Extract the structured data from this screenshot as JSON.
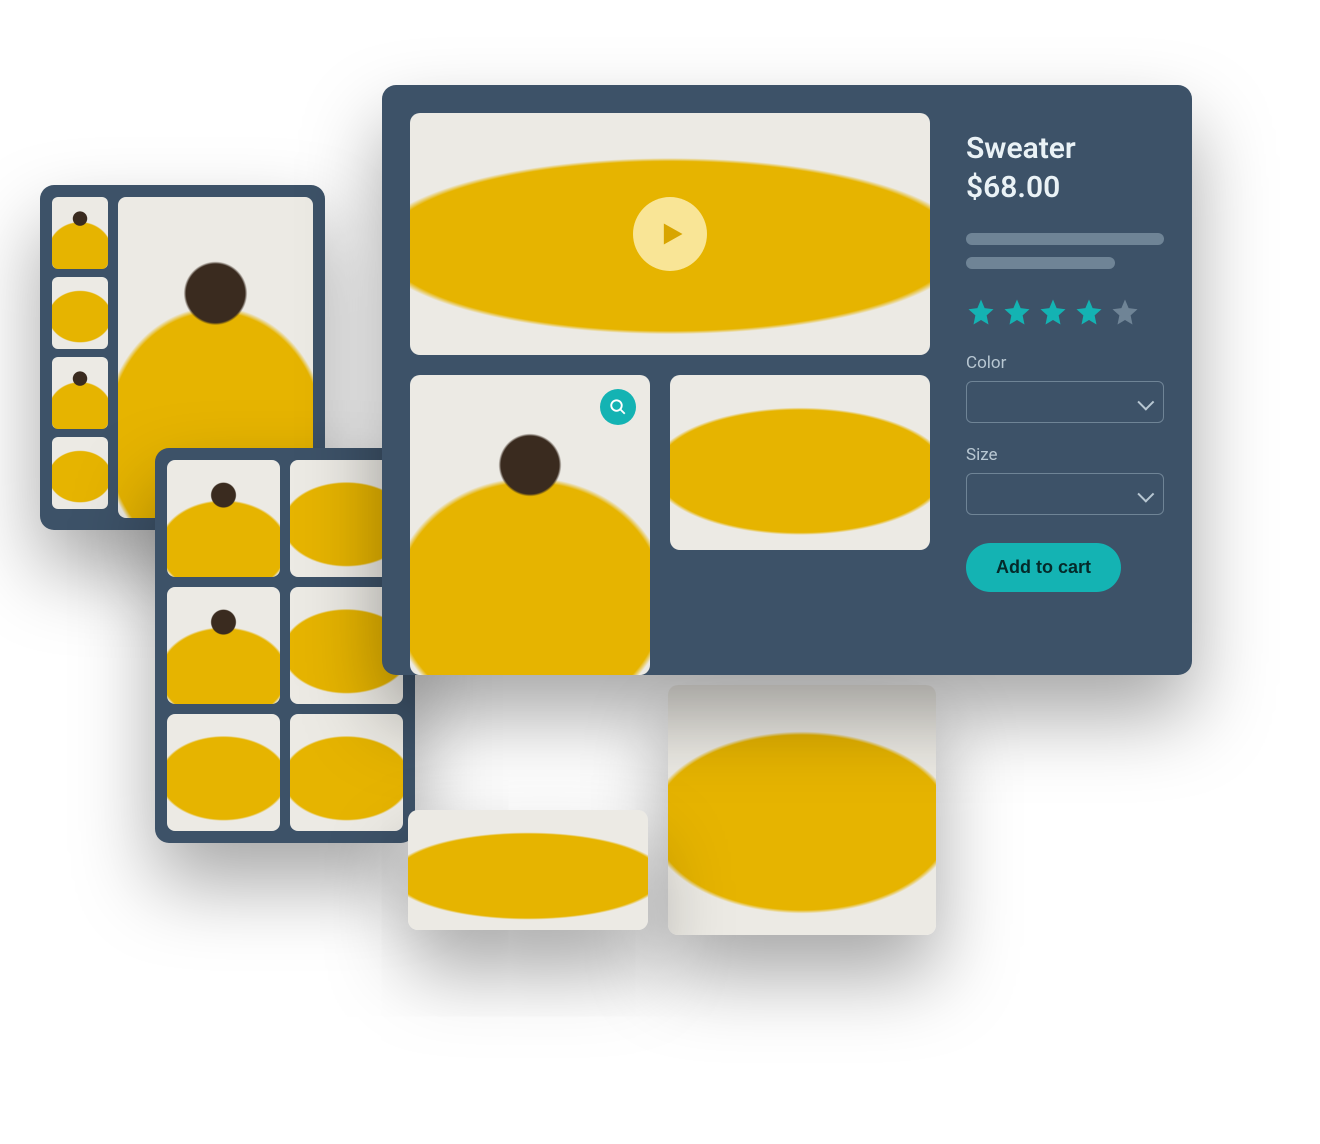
{
  "product": {
    "title": "Sweater",
    "price": "$68.00",
    "rating": 4,
    "rating_max": 5,
    "color_label": "Color",
    "size_label": "Size",
    "add_to_cart_label": "Add to cart"
  },
  "colors": {
    "panel_bg": "#3d5268",
    "accent": "#14b3b3",
    "muted": "#6f8496",
    "text": "#eaf2f6"
  },
  "gallery_mini": {
    "thumb_count": 4
  },
  "gallery_grid": {
    "tile_count": 6
  }
}
